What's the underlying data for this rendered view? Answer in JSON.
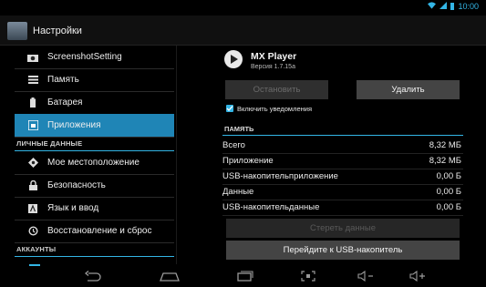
{
  "status": {
    "time": "10:00"
  },
  "actionbar": {
    "title": "Настройки"
  },
  "sidebar": {
    "items": [
      {
        "label": "ScreenshotSetting",
        "icon": "camera-icon"
      },
      {
        "label": "Память",
        "icon": "storage-icon"
      },
      {
        "label": "Батарея",
        "icon": "battery-icon"
      },
      {
        "label": "Приложения",
        "icon": "apps-icon",
        "selected": true
      }
    ],
    "section_personal": "ЛИЧНЫЕ ДАННЫЕ",
    "personal_items": [
      {
        "label": "Мое местоположение",
        "icon": "location-icon"
      },
      {
        "label": "Безопасность",
        "icon": "lock-icon"
      },
      {
        "label": "Язык и ввод",
        "icon": "language-icon"
      },
      {
        "label": "Восстановление и сброс",
        "icon": "backup-icon"
      }
    ],
    "section_accounts": "АККАУНТЫ"
  },
  "app_info": {
    "name": "MX Player",
    "version": "Версия 1.7.15a",
    "stop_button": "Остановить",
    "delete_button": "Удалить",
    "notifications_label": "Включить уведомления",
    "notifications_checked": true,
    "memory_header": "ПАМЯТЬ",
    "memory_rows": [
      {
        "key": "Всего",
        "value": "8,32 МБ"
      },
      {
        "key": "Приложение",
        "value": "8,32 МБ"
      },
      {
        "key": "USB-накопительприложение",
        "value": "0,00 Б"
      },
      {
        "key": "Данные",
        "value": "0,00 Б"
      },
      {
        "key": "USB-накопительданные",
        "value": "0,00 Б"
      }
    ],
    "clear_data_button": "Стереть данные",
    "move_usb_button": "Перейдите к USB-накопитель"
  },
  "colors": {
    "accent": "#33b5e5",
    "selected": "#1f85b6"
  }
}
